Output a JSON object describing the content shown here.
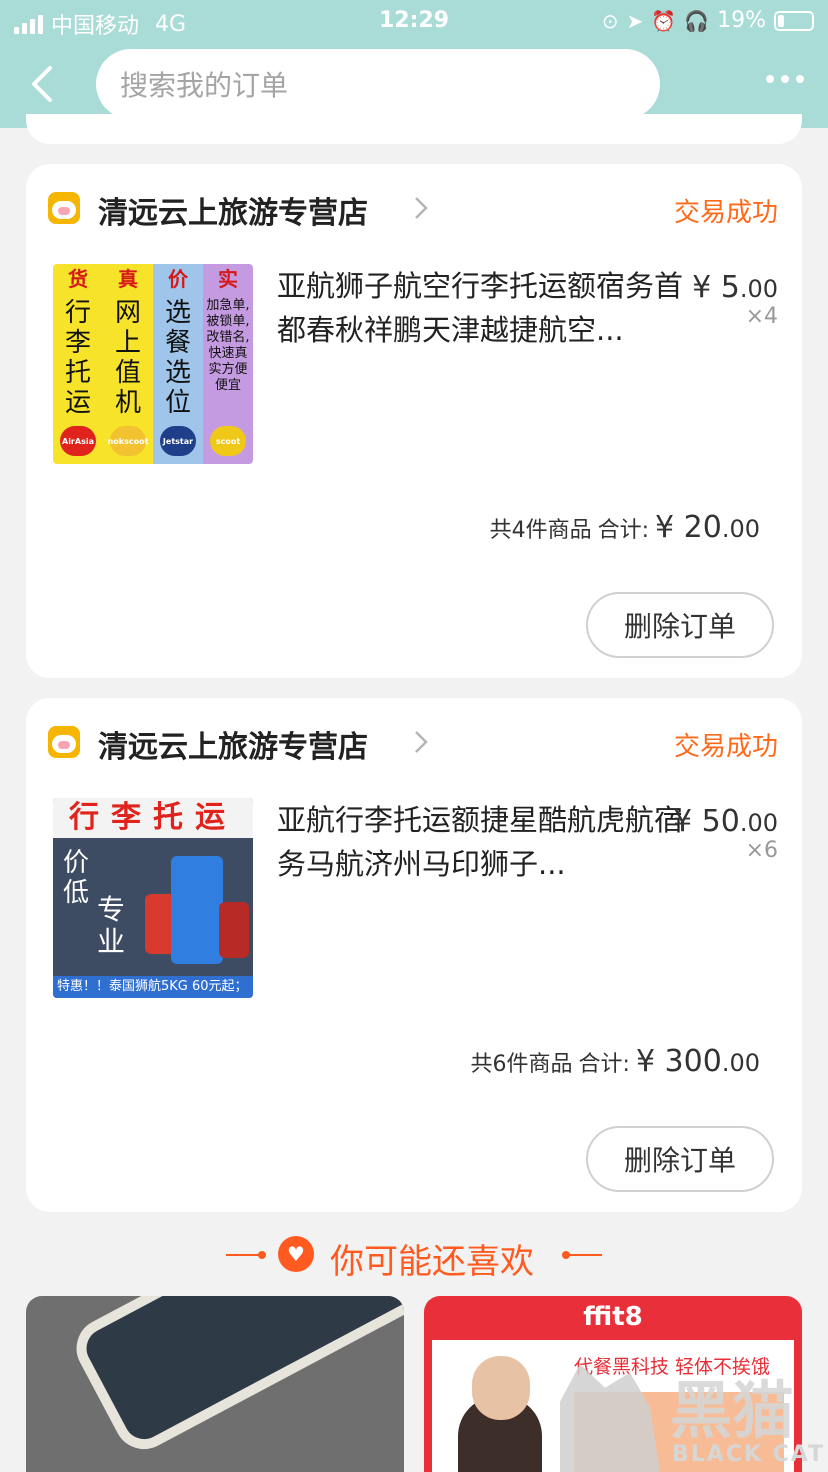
{
  "status_bar": {
    "carrier": "中国移动",
    "network": "4G",
    "time": "12:29",
    "battery": "19%",
    "battery_level": 0.19
  },
  "header": {
    "search_placeholder": "搜索我的订单"
  },
  "orders": [
    {
      "store": "清远云上旅游专营店",
      "status": "交易成功",
      "title": "亚航狮子航空行李托运额宿务首都春秋祥鹏天津越捷航空...",
      "price_int": "¥ 5",
      "price_dec": ".00",
      "qty": "×4",
      "count_text": "共4件商品",
      "total_label": "合计:",
      "total_int": "¥ 20",
      "total_dec": ".00",
      "delete_label": "删除订单",
      "thumb": {
        "cols": [
          {
            "top": "货",
            "text": "行李托运",
            "logo": "AirAsia",
            "bg": "#f7e32a",
            "logo_bg": "#e0231c"
          },
          {
            "top": "真",
            "text": "网上值机",
            "logo": "nokscoot",
            "bg": "#f7e32a",
            "logo_bg": "#f2c230"
          },
          {
            "top": "价",
            "text": "选餐选位",
            "logo": "Jetstar",
            "bg": "#9fc6ea",
            "logo_bg": "#1f3f8a"
          },
          {
            "top": "实",
            "text": "加急单,被锁单,改错名,快速真实方便便宜",
            "logo": "scoot",
            "bg": "#c49be0",
            "logo_bg": "#f0c818"
          }
        ]
      }
    },
    {
      "store": "清远云上旅游专营店",
      "status": "交易成功",
      "title": "亚航行李托运额捷星酷航虎航宿务马航济州马印狮子...",
      "price_int": "¥ 50",
      "price_dec": ".00",
      "qty": "×6",
      "count_text": "共6件商品",
      "total_label": "合计:",
      "total_int": "¥ 300",
      "total_dec": ".00",
      "delete_label": "删除订单",
      "thumb": {
        "banner": "行李托运",
        "line1": "价低",
        "line2": "专业",
        "footer": "特惠！！泰国狮航5KG 60元起；"
      }
    }
  ],
  "recommend": {
    "title": "你可能还喜欢",
    "items": [
      {
        "brand": ""
      },
      {
        "brand": "ffit8",
        "slogan": "代餐黑科技 轻体不挨饿"
      }
    ]
  },
  "watermark": {
    "text": "黑猫",
    "sub": "BLACK CAT"
  }
}
